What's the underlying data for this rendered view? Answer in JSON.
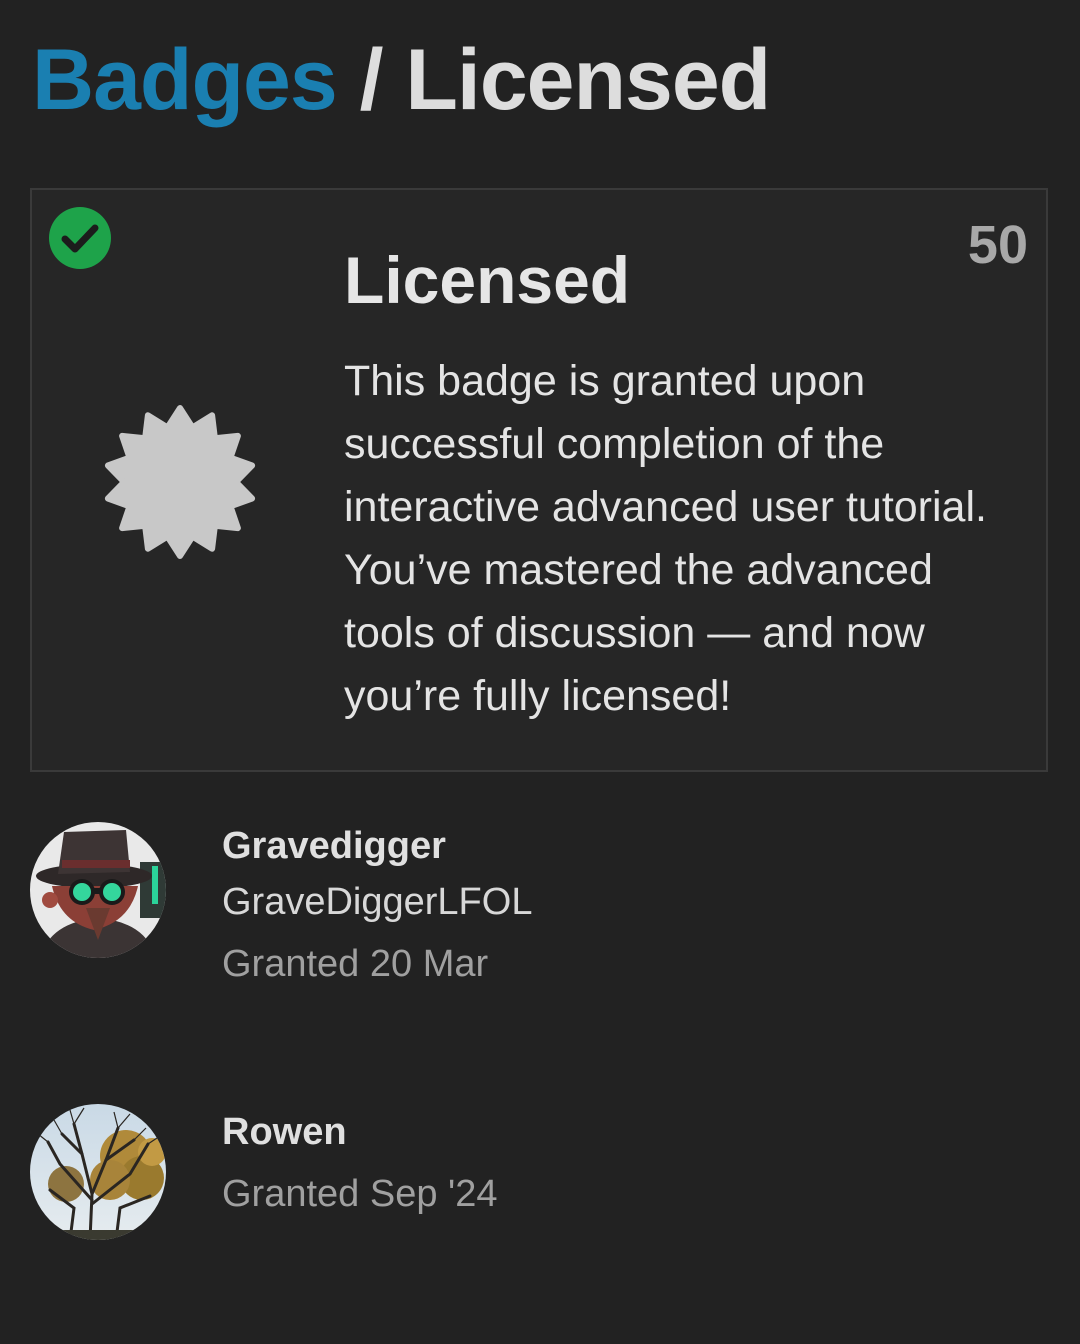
{
  "breadcrumb": {
    "parent": "Badges",
    "separator": "/",
    "current": "Licensed"
  },
  "badge": {
    "title": "Licensed",
    "granted_count": "50",
    "description": "This badge is granted upon successful completion of the interactive advanced user tutorial. You’ve mastered the advanced tools of discussion — and now you’re fully licensed!",
    "owned": true,
    "check_color": "#1ea34a",
    "icon_color": "#c8c8c8"
  },
  "colors": {
    "background": "#222222",
    "link": "#1a7fb1",
    "text": "#dddddd",
    "muted": "#a0a0a0"
  },
  "users": [
    {
      "name": "Gravedigger",
      "username": "GraveDiggerLFOL",
      "granted": "Granted 20 Mar",
      "avatar": "cartoon-character-avatar"
    },
    {
      "name": "Rowen",
      "granted": "Granted Sep '24",
      "avatar": "tree-photo-avatar"
    }
  ]
}
